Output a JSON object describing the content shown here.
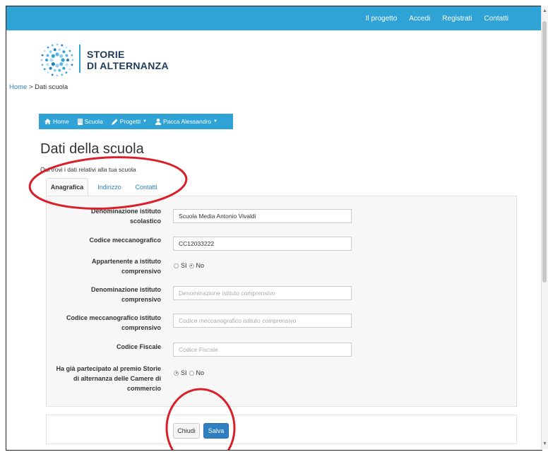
{
  "topnav": [
    "Il progetto",
    "Accedi",
    "Registrati",
    "Contatti"
  ],
  "logo": {
    "line1": "STORIE",
    "line2": "DI ALTERNANZA"
  },
  "breadcrumb": {
    "home": "Home",
    "separator": " > ",
    "current": "Dati scuola"
  },
  "menu": {
    "home": "Home",
    "scuola": "Scuola",
    "progetti": "Progetti",
    "user": "Pacca Alessandro"
  },
  "page": {
    "title": "Dati della scuola",
    "subtitle": "Qui trovi i dati relativi alla tua scuola"
  },
  "tabs": [
    "Anagrafica",
    "Indirizzo",
    "Contatti"
  ],
  "form": {
    "denominazione": {
      "label": "Denominazione istituto scolastico",
      "value": "Scuola Media Antonio Vivaldi"
    },
    "codice": {
      "label": "Codice meccanografico",
      "value": "CC12033222"
    },
    "appartenente": {
      "label": "Appartenente a istituto comprensivo",
      "opt_si": "SI",
      "opt_no": "No",
      "selected": "No"
    },
    "den_comprensivo": {
      "label": "Denominazione istituto comprensivo",
      "placeholder": "Denominazione istituto comprensivo"
    },
    "cod_comprensivo": {
      "label": "Codice meccanografico istituto comprensivo",
      "placeholder": "Codice meccanografico istituto comprensivo"
    },
    "codice_fiscale": {
      "label": "Codice Fiscale",
      "placeholder": "Codice Fiscale"
    },
    "premio": {
      "label": "Ha già partecipato al premio Storie di alternanza delle Camere di commercio",
      "opt_si": "SI",
      "opt_no": "No",
      "selected": "SI"
    }
  },
  "buttons": {
    "chiudi": "Chiudi",
    "salva": "Salva"
  },
  "colors": {
    "brand_blue": "#2fa2d6",
    "link_blue": "#2f7fc1",
    "annotation_red": "#d9202a"
  }
}
